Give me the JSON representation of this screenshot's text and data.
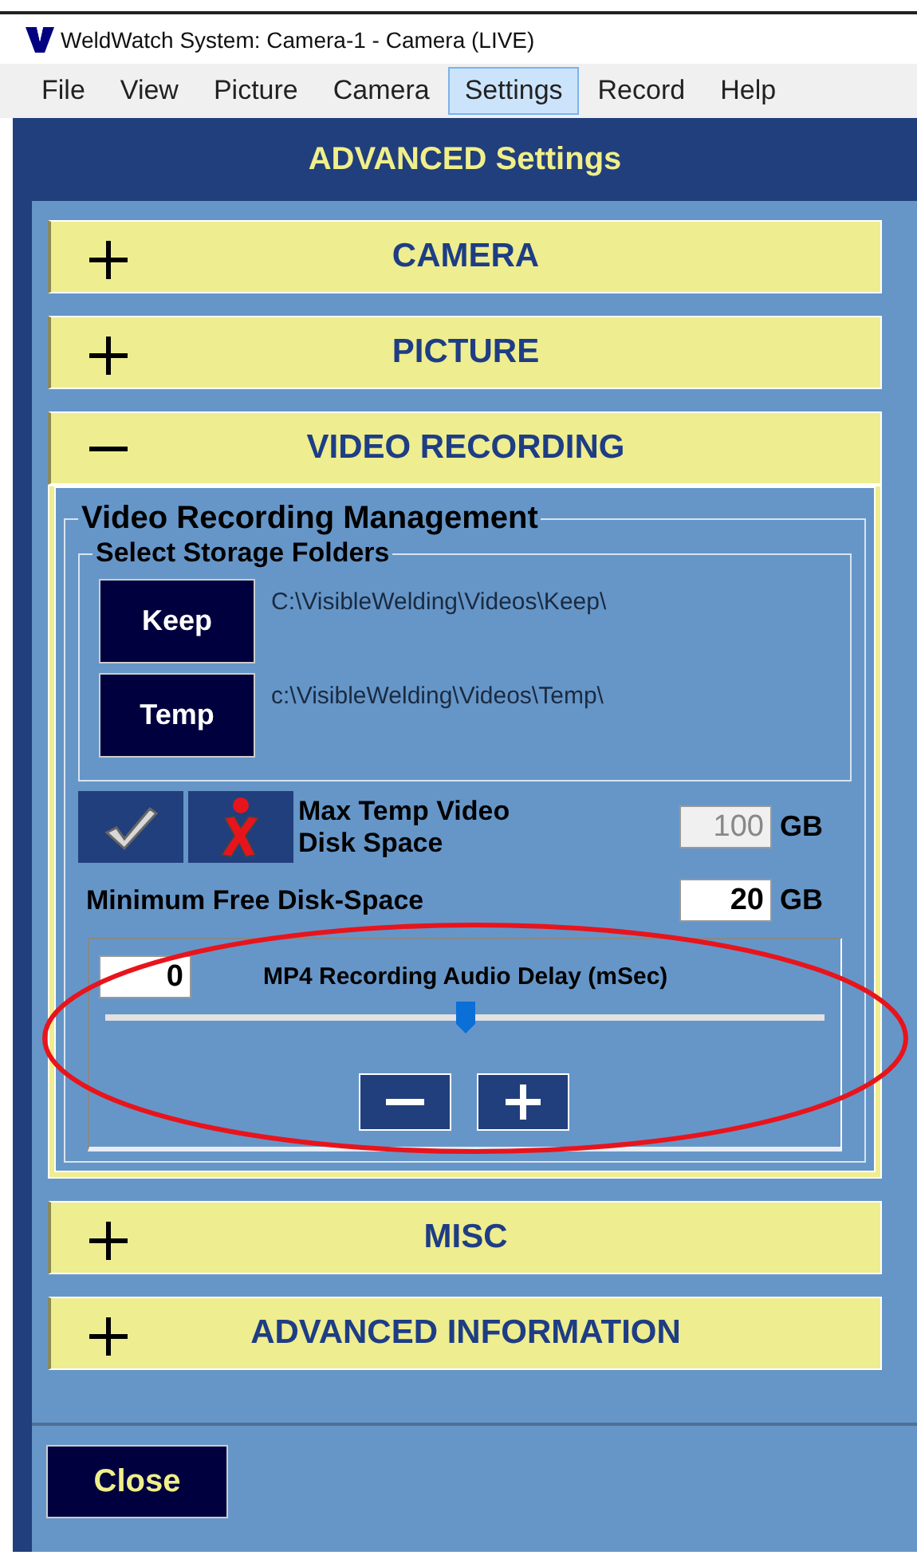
{
  "window": {
    "title": "WeldWatch System:  Camera-1 - Camera (LIVE)"
  },
  "menu": [
    {
      "label": "File",
      "selected": false
    },
    {
      "label": "View",
      "selected": false
    },
    {
      "label": "Picture",
      "selected": false
    },
    {
      "label": "Camera",
      "selected": false
    },
    {
      "label": "Settings",
      "selected": true
    },
    {
      "label": "Record",
      "selected": false
    },
    {
      "label": "Help",
      "selected": false
    }
  ],
  "header": "ADVANCED Settings",
  "sections": [
    {
      "title": "CAMERA",
      "expanded": false
    },
    {
      "title": "PICTURE",
      "expanded": false
    },
    {
      "title": "VIDEO RECORDING",
      "expanded": true,
      "group": {
        "title": "Video Recording Management",
        "storage": {
          "title": "Select Storage Folders",
          "folders": [
            {
              "button": "Keep",
              "path": "C:\\VisibleWelding\\Videos\\Keep\\"
            },
            {
              "button": "Temp",
              "path": "c:\\VisibleWelding\\Videos\\Temp\\"
            }
          ]
        },
        "max_temp": {
          "label": "Max Temp Video Disk Space",
          "value": "100",
          "unit": "GB",
          "disabled": true
        },
        "min_free": {
          "label": "Minimum Free Disk-Space",
          "value": "20",
          "unit": "GB",
          "disabled": false
        },
        "audio_delay": {
          "value": "0",
          "label": "MP4 Recording Audio Delay (mSec)",
          "level": 0.5
        }
      }
    },
    {
      "title": "MISC",
      "expanded": false
    },
    {
      "title": "ADVANCED INFORMATION",
      "expanded": false
    }
  ],
  "close_button": "Close"
}
